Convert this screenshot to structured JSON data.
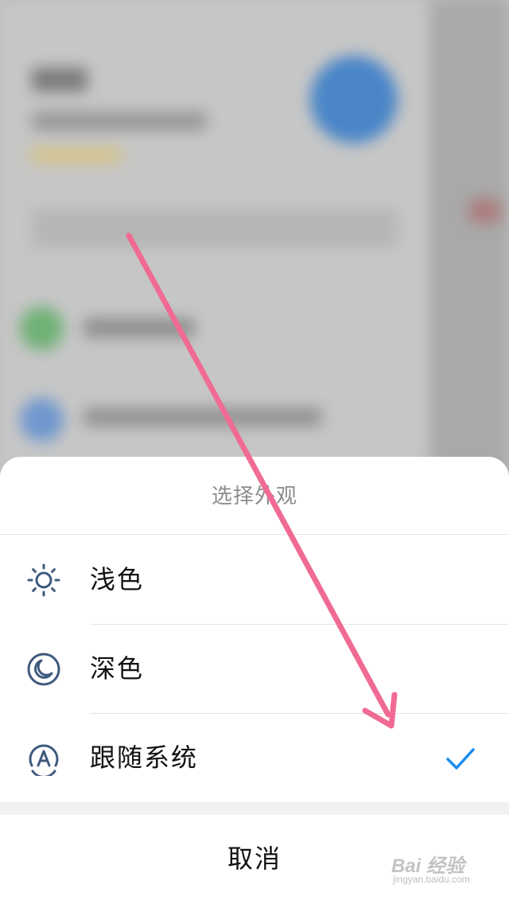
{
  "sheet": {
    "title": "选择外观",
    "options": [
      {
        "label": "浅色",
        "icon": "sun-icon",
        "selected": false
      },
      {
        "label": "深色",
        "icon": "moon-icon",
        "selected": false
      },
      {
        "label": "跟随系统",
        "icon": "auto-theme-icon",
        "selected": true
      }
    ],
    "cancel_label": "取消"
  },
  "colors": {
    "icon": "#3f5a7e",
    "check": "#1a8cf0",
    "annotation_arrow": "#f06b93"
  },
  "watermark": {
    "main": "Bai 经验",
    "sub": "jingyan.baidu.com"
  }
}
